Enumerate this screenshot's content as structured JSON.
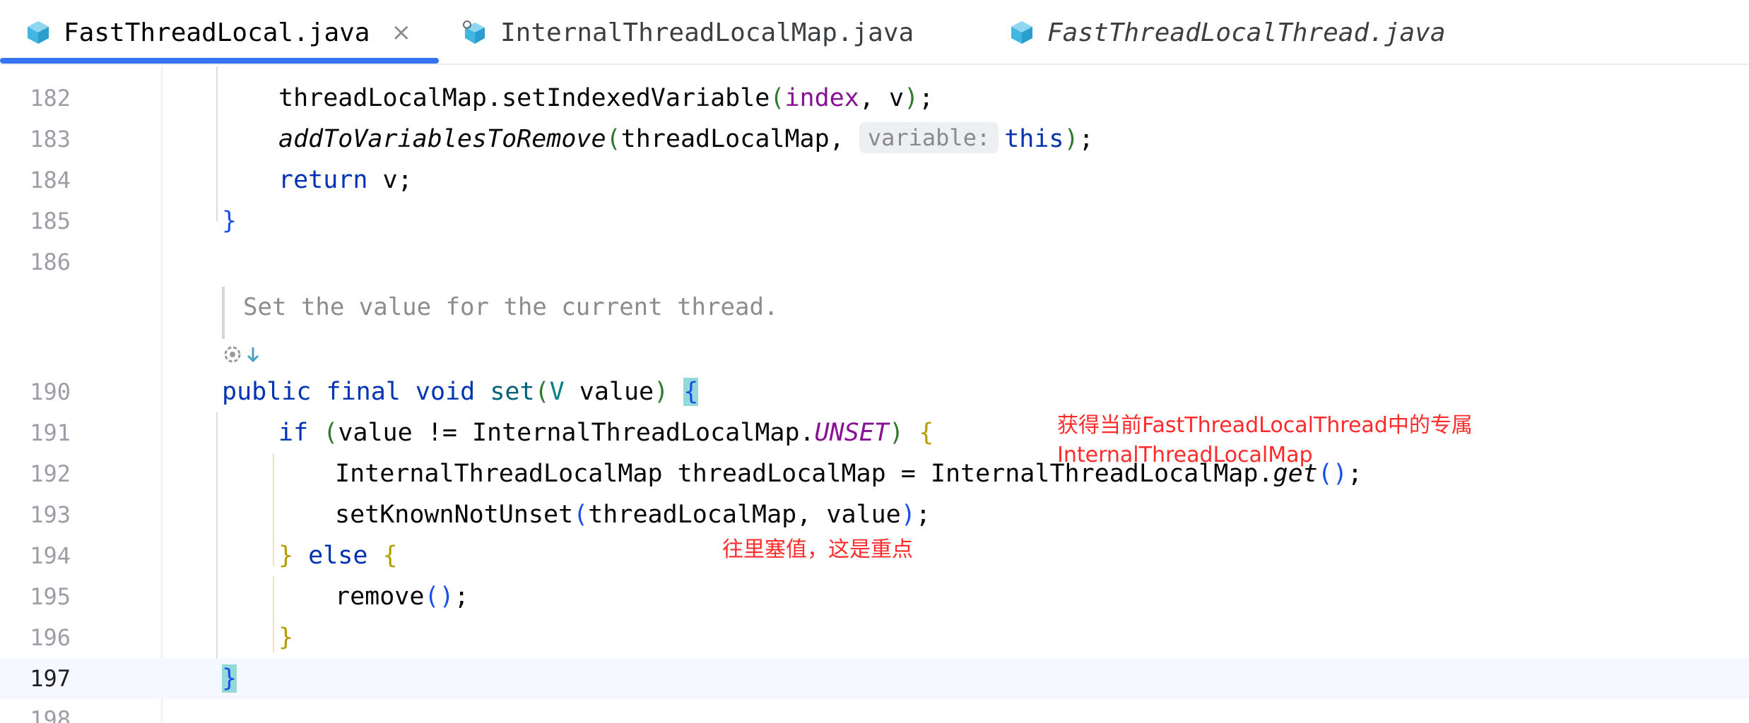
{
  "tabs": [
    {
      "label": "FastThreadLocal.java",
      "active": true,
      "close": "×",
      "icon": "java-class-icon"
    },
    {
      "label": "InternalThreadLocalMap.java",
      "active": false,
      "icon": "java-class-icon"
    },
    {
      "label": "FastThreadLocalThread.java",
      "active": false,
      "italic": true,
      "icon": "java-class-icon"
    }
  ],
  "line_numbers": [
    "182",
    "183",
    "184",
    "185",
    "186",
    "190",
    "191",
    "192",
    "193",
    "194",
    "195",
    "196",
    "197",
    "198"
  ],
  "code": {
    "l182": {
      "obj": "threadLocalMap.setIndexedVariable",
      "open": "(",
      "arg1": "index",
      "rest": ", v",
      "close": ")",
      "semi": ";"
    },
    "l183": {
      "method": "addToVariablesToRemove",
      "open": "(",
      "arg1": "threadLocalMap, ",
      "hint": "variable:",
      "arg2": "this",
      "close": ")",
      "semi": ";"
    },
    "l184": {
      "kw": "return",
      "rest": " v;"
    },
    "l185": {
      "brace": "}"
    },
    "doc": "Set the value for the current thread.",
    "l190": {
      "kw": "public final void",
      "fn": "set",
      "open": "(",
      "type": "V",
      "param": " value",
      "close": ")",
      "brace": "{"
    },
    "l191": {
      "kw": "if",
      "open": "(",
      "expr": "value != InternalThreadLocalMap.",
      "const": "UNSET",
      "close": ")",
      "brace": "{"
    },
    "l192": {
      "text": "InternalThreadLocalMap threadLocalMap = InternalThreadLocalMap.",
      "method": "get",
      "parens": "()",
      "semi": ";"
    },
    "l193": {
      "text": "setKnownNotUnset",
      "open": "(",
      "args": "threadLocalMap, value",
      "close": ")",
      "semi": ";"
    },
    "l194": {
      "brace_close": "}",
      "kw": "else",
      "brace_open": "{"
    },
    "l195": {
      "text": "remove",
      "parens": "()",
      "semi": ";"
    },
    "l196": {
      "brace": "}"
    },
    "l197": {
      "brace": "}"
    }
  },
  "annotations": {
    "note1": "获得当前FastThreadLocalThread中的专属\nInternalThreadLocalMap",
    "note2": "往里塞值，这是重点"
  },
  "colors": {
    "accent_tab": "#3574f0",
    "annotation": "#ff2a2a",
    "keyword": "#0033b3",
    "brace_highlight": "#93d9d9"
  }
}
